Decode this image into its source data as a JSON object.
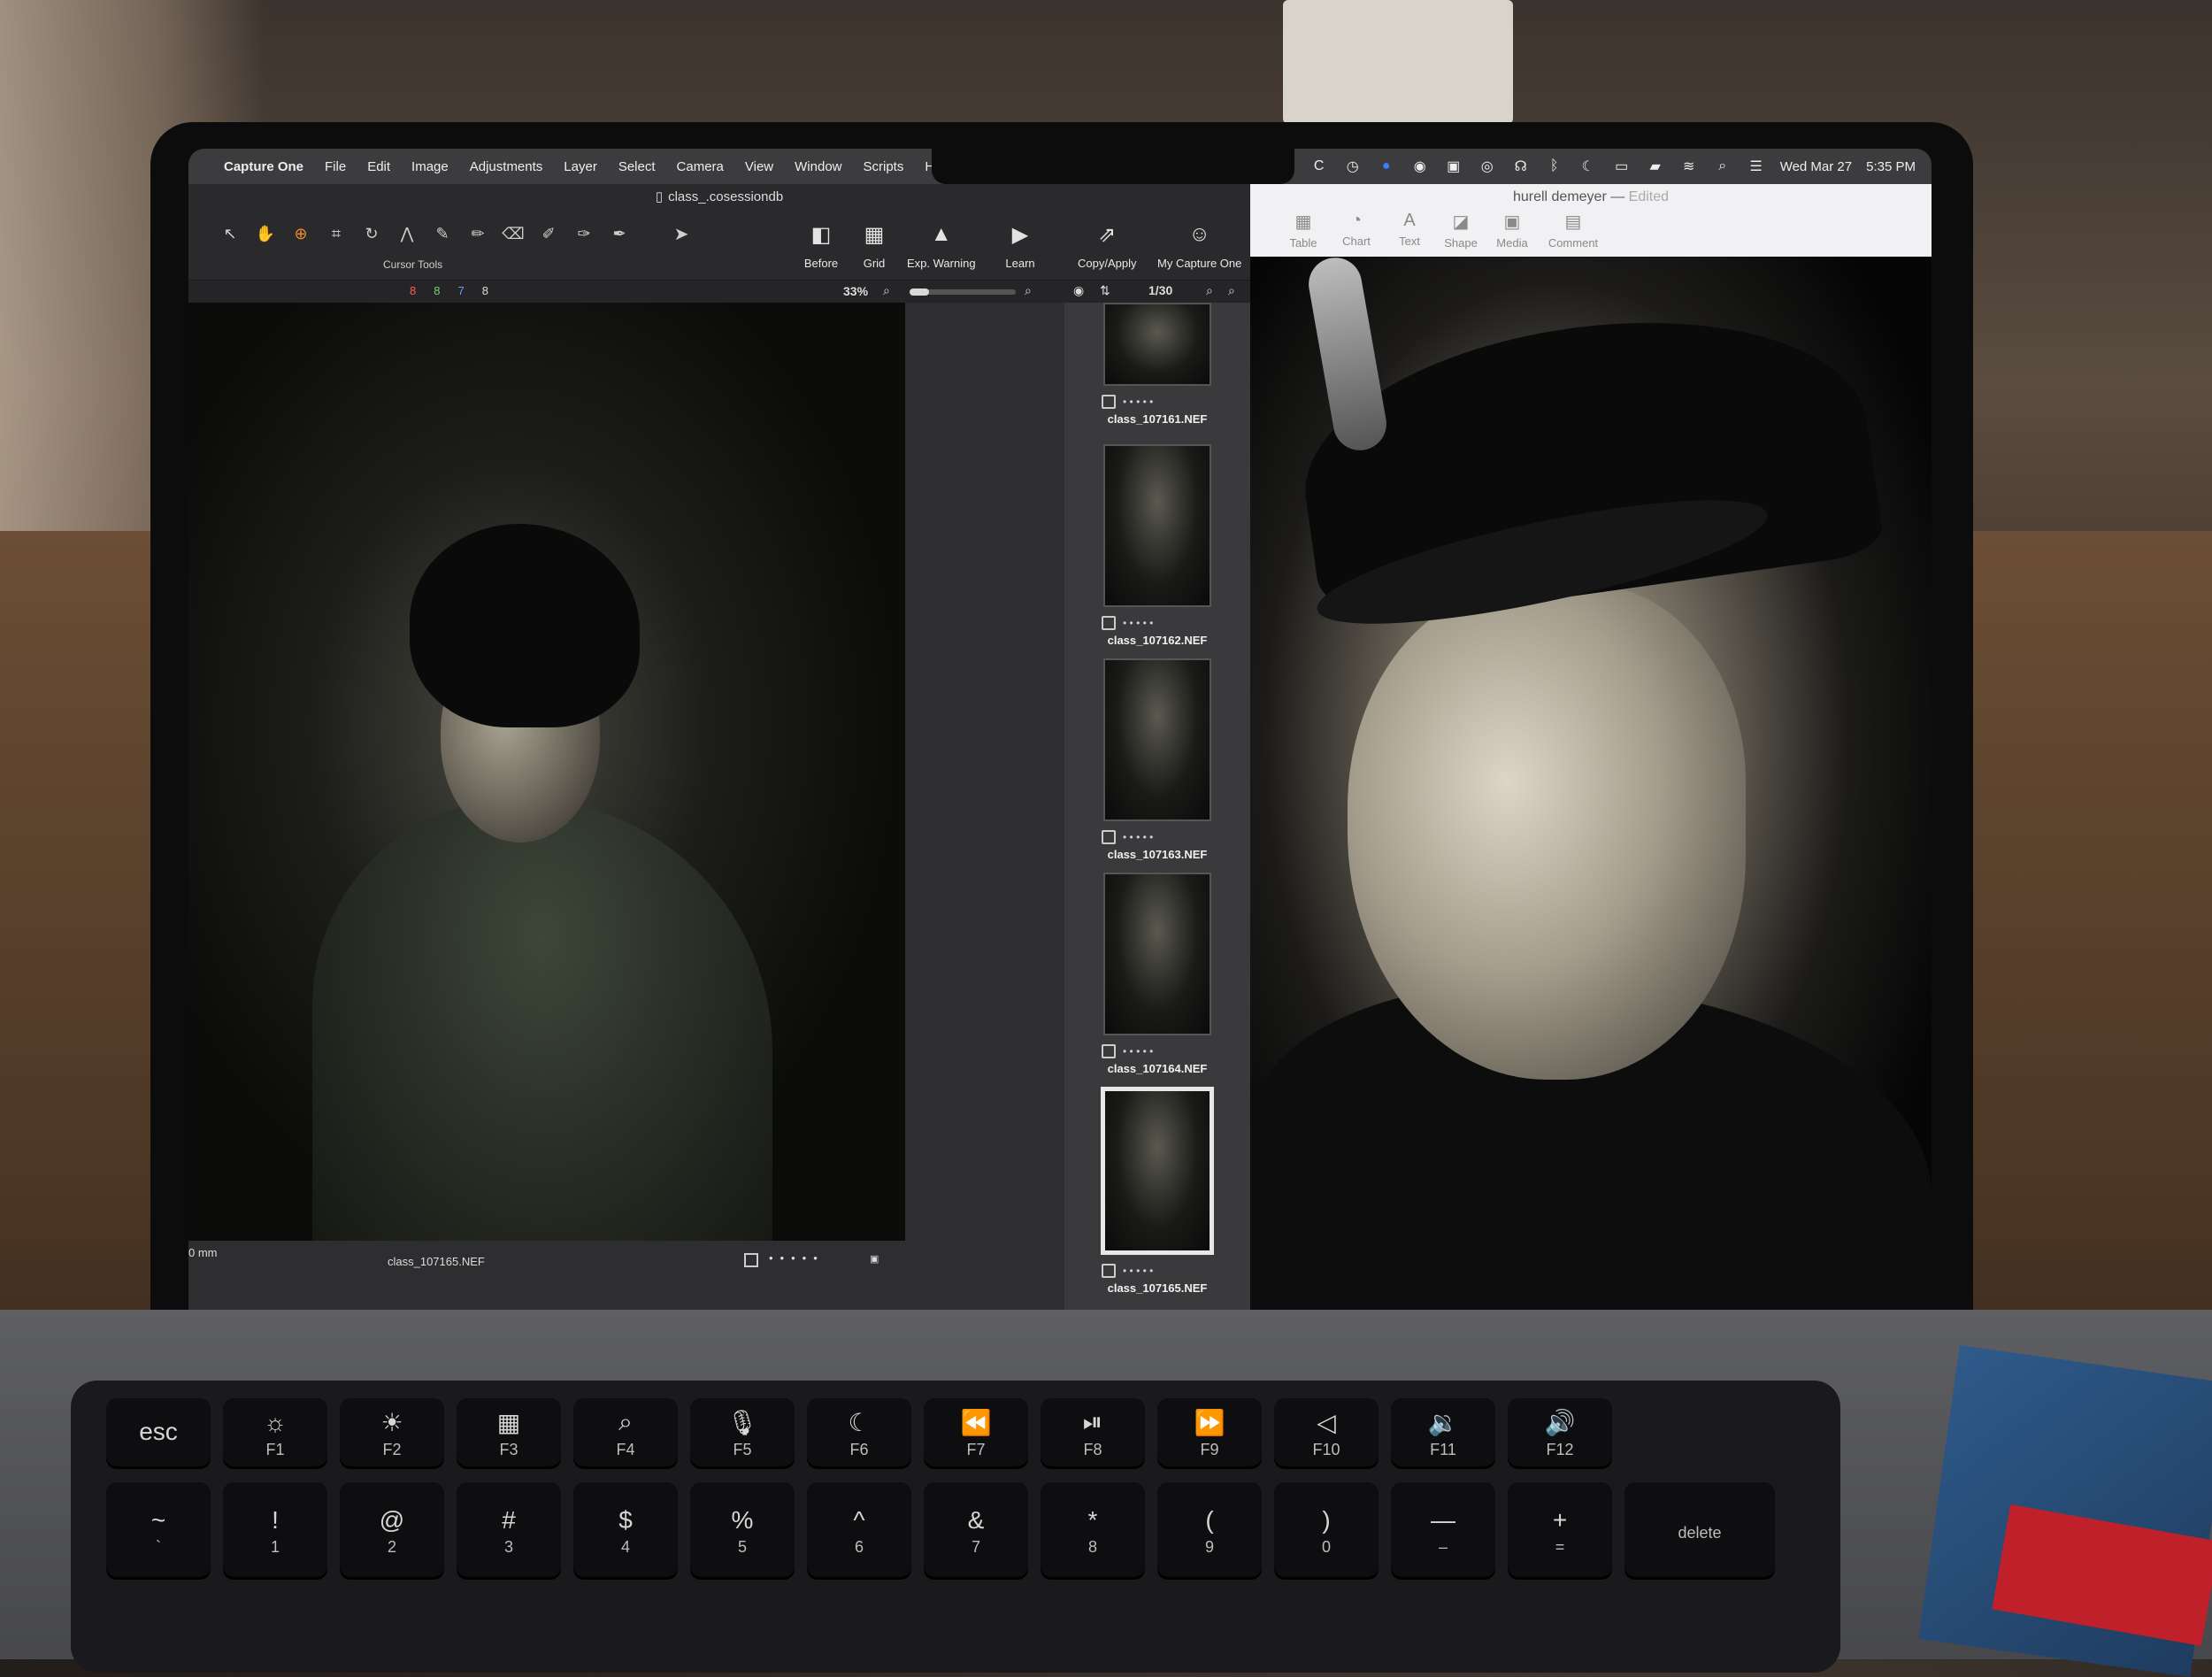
{
  "menubar": {
    "app": "Capture One",
    "items": [
      "File",
      "Edit",
      "Image",
      "Adjustments",
      "Layer",
      "Select",
      "Camera",
      "View",
      "Window",
      "Scripts",
      "Help"
    ],
    "date": "Wed Mar 27",
    "time": "5:35 PM"
  },
  "capture_one": {
    "window_title": "class_.cosessiondb",
    "cursor_tools_label": "Cursor Tools",
    "counts": [
      "8",
      "8",
      "7",
      "8"
    ],
    "count_colors": [
      "#ff5a5a",
      "#6bd66b",
      "#5aa0ff",
      "#e6e6e6"
    ],
    "toolbar": {
      "before": "Before",
      "grid": "Grid",
      "exp_warning": "Exp. Warning",
      "learn": "Learn",
      "copy_apply": "Copy/Apply",
      "my_capture_one": "My Capture One"
    },
    "zoom": "33%",
    "browser_count": "1/30",
    "viewer": {
      "mm_label": "0 mm",
      "filename": "class_107165.NEF"
    },
    "filmstrip": [
      {
        "name": "class_107161.NEF",
        "selected": false
      },
      {
        "name": "class_107162.NEF",
        "selected": false
      },
      {
        "name": "class_107163.NEF",
        "selected": false
      },
      {
        "name": "class_107164.NEF",
        "selected": false
      },
      {
        "name": "class_107165.NEF",
        "selected": true
      }
    ]
  },
  "keynote": {
    "title": "hurell demeyer",
    "edited": "Edited",
    "buttons": [
      "Table",
      "Chart",
      "Text",
      "Shape",
      "Media",
      "Comment"
    ]
  },
  "keyboard": {
    "fn_row": [
      {
        "top": "esc",
        "sub": ""
      },
      {
        "top": "☼",
        "sub": "F1"
      },
      {
        "top": "☀",
        "sub": "F2"
      },
      {
        "top": "▦",
        "sub": "F3"
      },
      {
        "top": "⌕",
        "sub": "F4"
      },
      {
        "top": "🎙",
        "sub": "F5"
      },
      {
        "top": "☾",
        "sub": "F6"
      },
      {
        "top": "⏪",
        "sub": "F7"
      },
      {
        "top": "⏯",
        "sub": "F8"
      },
      {
        "top": "⏩",
        "sub": "F9"
      },
      {
        "top": "◁",
        "sub": "F10"
      },
      {
        "top": "🔉",
        "sub": "F11"
      },
      {
        "top": "🔊",
        "sub": "F12"
      }
    ],
    "num_row": [
      {
        "top": "~",
        "sub": "`"
      },
      {
        "top": "!",
        "sub": "1"
      },
      {
        "top": "@",
        "sub": "2"
      },
      {
        "top": "#",
        "sub": "3"
      },
      {
        "top": "$",
        "sub": "4"
      },
      {
        "top": "%",
        "sub": "5"
      },
      {
        "top": "^",
        "sub": "6"
      },
      {
        "top": "&",
        "sub": "7"
      },
      {
        "top": "*",
        "sub": "8"
      },
      {
        "top": "(",
        "sub": "9"
      },
      {
        "top": ")",
        "sub": "0"
      },
      {
        "top": "—",
        "sub": "–"
      },
      {
        "top": "+",
        "sub": "="
      },
      {
        "top": "",
        "sub": "delete"
      }
    ]
  }
}
